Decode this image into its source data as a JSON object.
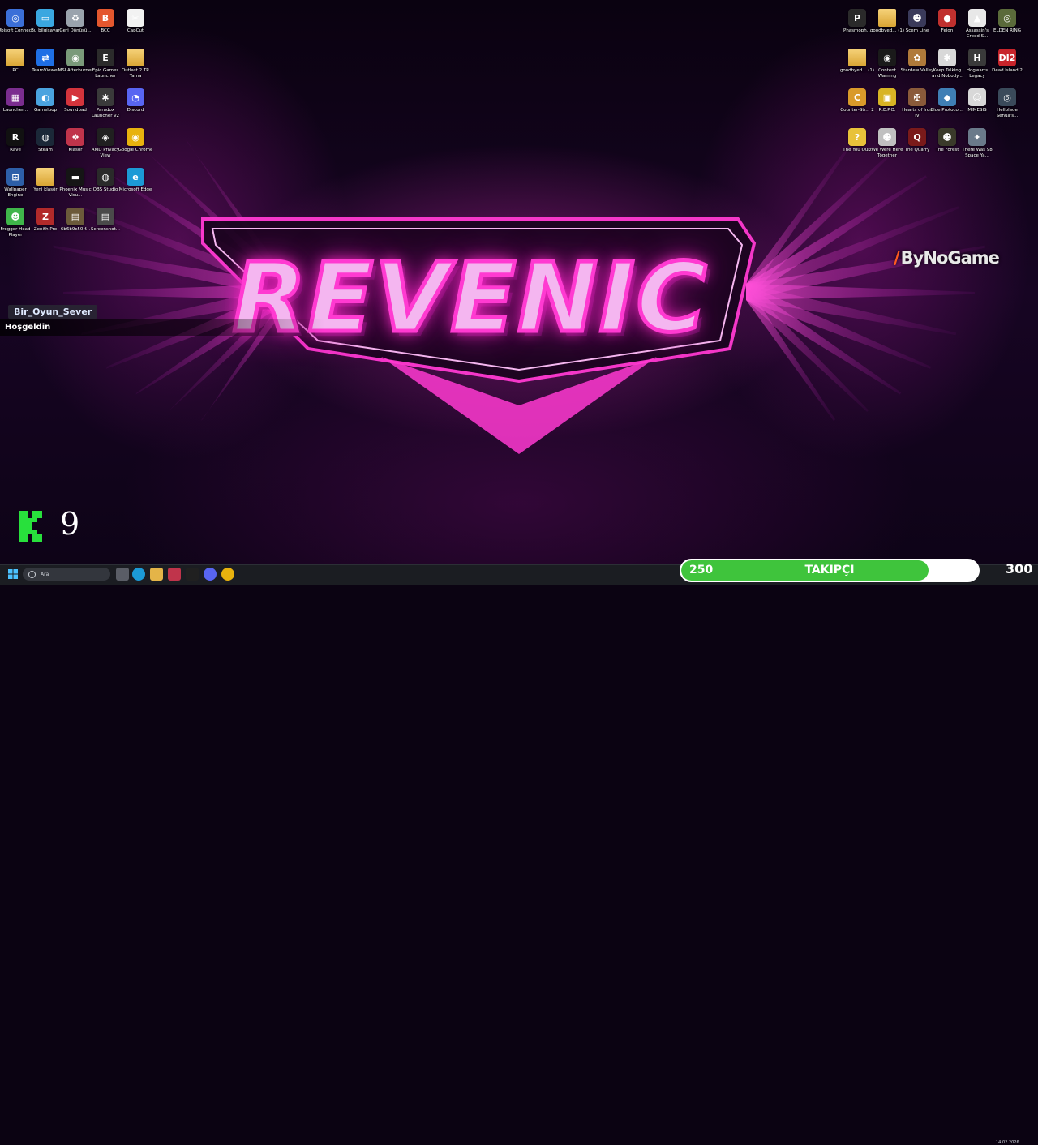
{
  "wallpaper": {
    "title": "REVENIC",
    "accent": "#ff2dc8"
  },
  "desktop_left": [
    {
      "label": "Ubisoft Connect",
      "icon": "ubisoft-icon",
      "color": "#3b6fd8",
      "glyph": "◎"
    },
    {
      "label": "Bu bilgisayar",
      "icon": "this-pc-icon",
      "color": "#3aa7e0",
      "glyph": "▭"
    },
    {
      "label": "Geri Dönüşü...",
      "icon": "recycle-bin-icon",
      "color": "#9aa3ad",
      "glyph": "♻"
    },
    {
      "label": "BCC",
      "icon": "bcc-icon",
      "color": "#e4572e",
      "glyph": "B"
    },
    {
      "label": "CapCut",
      "icon": "capcut-icon",
      "color": "#f2f2f2",
      "glyph": "✂"
    },
    {
      "label": "PC",
      "icon": "folder-icon",
      "color": "#e4b448",
      "glyph": ""
    },
    {
      "label": "TeamViewer",
      "icon": "teamviewer-icon",
      "color": "#1f6fe5",
      "glyph": "⇄"
    },
    {
      "label": "MSI Afterburner",
      "icon": "msi-afterburner-icon",
      "color": "#7a9a7a",
      "glyph": "◉"
    },
    {
      "label": "Epic Games Launcher",
      "icon": "epic-games-icon",
      "color": "#2b2b2b",
      "glyph": "E"
    },
    {
      "label": "Outlast 2 TR Yama",
      "icon": "folder-icon",
      "color": "#e4b448",
      "glyph": ""
    },
    {
      "label": "Launcher...",
      "icon": "launcher-icon",
      "color": "#7b2d8f",
      "glyph": "▦"
    },
    {
      "label": "Gameloop",
      "icon": "gameloop-icon",
      "color": "#4aa3df",
      "glyph": "◐"
    },
    {
      "label": "Soundpad",
      "icon": "soundpad-icon",
      "color": "#d4343c",
      "glyph": "▶"
    },
    {
      "label": "Paradox Launcher v2",
      "icon": "paradox-icon",
      "color": "#3a3a3a",
      "glyph": "✱"
    },
    {
      "label": "Discord",
      "icon": "discord-icon",
      "color": "#5865f2",
      "glyph": "◔"
    },
    {
      "label": "Rave",
      "icon": "rave-icon",
      "color": "#111111",
      "glyph": "R"
    },
    {
      "label": "Steam",
      "icon": "steam-icon",
      "color": "#1b2838",
      "glyph": "◍"
    },
    {
      "label": "Klasör",
      "icon": "folder-red-icon",
      "color": "#c0344b",
      "glyph": "❖"
    },
    {
      "label": "AMD Privacy View",
      "icon": "amd-privacy-icon",
      "color": "#202020",
      "glyph": "◈"
    },
    {
      "label": "Google Chrome",
      "icon": "chrome-icon",
      "color": "#e8b20e",
      "glyph": "◉"
    },
    {
      "label": "Wallpaper Engine",
      "icon": "wallpaper-engine-icon",
      "color": "#2d5fa8",
      "glyph": "⊞"
    },
    {
      "label": "Yeni klasör",
      "icon": "folder-icon",
      "color": "#e4b448",
      "glyph": ""
    },
    {
      "label": "Phoenix Music Visu...",
      "icon": "phoenix-icon",
      "color": "#151515",
      "glyph": "▬"
    },
    {
      "label": "OBS Studio",
      "icon": "obs-icon",
      "color": "#2a2a2a",
      "glyph": "◍"
    },
    {
      "label": "Microsoft Edge",
      "icon": "edge-icon",
      "color": "#1c9ad6",
      "glyph": "e"
    },
    {
      "label": "Frogger Head Player",
      "icon": "frog-icon",
      "color": "#3fb54a",
      "glyph": "☻"
    },
    {
      "label": "Zenith Pro",
      "icon": "zenith-icon",
      "color": "#b22a2a",
      "glyph": "Z"
    },
    {
      "label": "6b6b9c50-f...",
      "icon": "image-file-icon",
      "color": "#6b5a3a",
      "glyph": "▤"
    },
    {
      "label": "Screenshot...",
      "icon": "screenshot-icon",
      "color": "#4a4a4a",
      "glyph": "▤"
    }
  ],
  "desktop_right": [
    {
      "label": "Phasmoph...",
      "icon": "phasmophobia-icon",
      "color": "#2a2a2a",
      "glyph": "P"
    },
    {
      "label": "goodbyed... (1)",
      "icon": "folder-icon",
      "color": "#e4b448",
      "glyph": ""
    },
    {
      "label": "Scem Line",
      "icon": "scem-line-icon",
      "color": "#3a3a5a",
      "glyph": "☻"
    },
    {
      "label": "Feign",
      "icon": "feign-icon",
      "color": "#c0302e",
      "glyph": "●"
    },
    {
      "label": "Assassin's Creed S...",
      "icon": "assassins-creed-icon",
      "color": "#e8e8e8",
      "glyph": "▲"
    },
    {
      "label": "ELDEN RING",
      "icon": "elden-ring-icon",
      "color": "#5a6a3a",
      "glyph": "◎"
    },
    {
      "label": "goodbyed... (1)",
      "icon": "folder-icon",
      "color": "#e4b448",
      "glyph": ""
    },
    {
      "label": "Content Warning",
      "icon": "content-warning-icon",
      "color": "#1a1a1a",
      "glyph": "◉"
    },
    {
      "label": "Stardew Valley",
      "icon": "stardew-icon",
      "color": "#b07a3a",
      "glyph": "✿"
    },
    {
      "label": "Keep Talking and Nobody...",
      "icon": "keep-talking-icon",
      "color": "#d8d8d8",
      "glyph": "✱"
    },
    {
      "label": "Hogwarts Legacy",
      "icon": "hogwarts-icon",
      "color": "#3a3a3a",
      "glyph": "H"
    },
    {
      "label": "Dead Island 2",
      "icon": "dead-island-icon",
      "color": "#c8242b",
      "glyph": "DI2"
    },
    {
      "label": "Counter-Str... 2",
      "icon": "cs2-icon",
      "color": "#d99a2a",
      "glyph": "C"
    },
    {
      "label": "R.E.P.O.",
      "icon": "repo-icon",
      "color": "#d8b424",
      "glyph": "▣"
    },
    {
      "label": "Hearts of Iron IV",
      "icon": "hoi4-icon",
      "color": "#8a5a3a",
      "glyph": "✠"
    },
    {
      "label": "Blue Protocol...",
      "icon": "blue-protocol-icon",
      "color": "#3f7fb5",
      "glyph": "◆"
    },
    {
      "label": "MIMESIS",
      "icon": "mimesis-icon",
      "color": "#d8d8d8",
      "glyph": "☺"
    },
    {
      "label": "Hellblade Senua's...",
      "icon": "hellblade-icon",
      "color": "#3a4a5a",
      "glyph": "◎"
    },
    {
      "label": "The You Quiz",
      "icon": "you-quiz-icon",
      "color": "#e8c23a",
      "glyph": "?"
    },
    {
      "label": "We Were Here Together",
      "icon": "we-were-here-icon",
      "color": "#c0c0c0",
      "glyph": "☻"
    },
    {
      "label": "The Quarry",
      "icon": "quarry-icon",
      "color": "#7a1a1a",
      "glyph": "Q"
    },
    {
      "label": "The Forest",
      "icon": "forest-icon",
      "color": "#3a3a2a",
      "glyph": "☻"
    },
    {
      "label": "There Was 98 Space Ya...",
      "icon": "space-game-icon",
      "color": "#6a7a8a",
      "glyph": "✦"
    }
  ],
  "overlay": {
    "welcome_name": "Bir_Oyun_Sever",
    "welcome_text": "Hoşgeldin",
    "sponsor": "ByNoGame",
    "kick_count": "9"
  },
  "taskbar": {
    "search_placeholder": "Ara",
    "date": "14.02.2026"
  },
  "follower_goal": {
    "current": "250",
    "label": "TAKIPÇI",
    "target": "300",
    "progress": 0.8333,
    "fill_color": "#3fc43c"
  }
}
